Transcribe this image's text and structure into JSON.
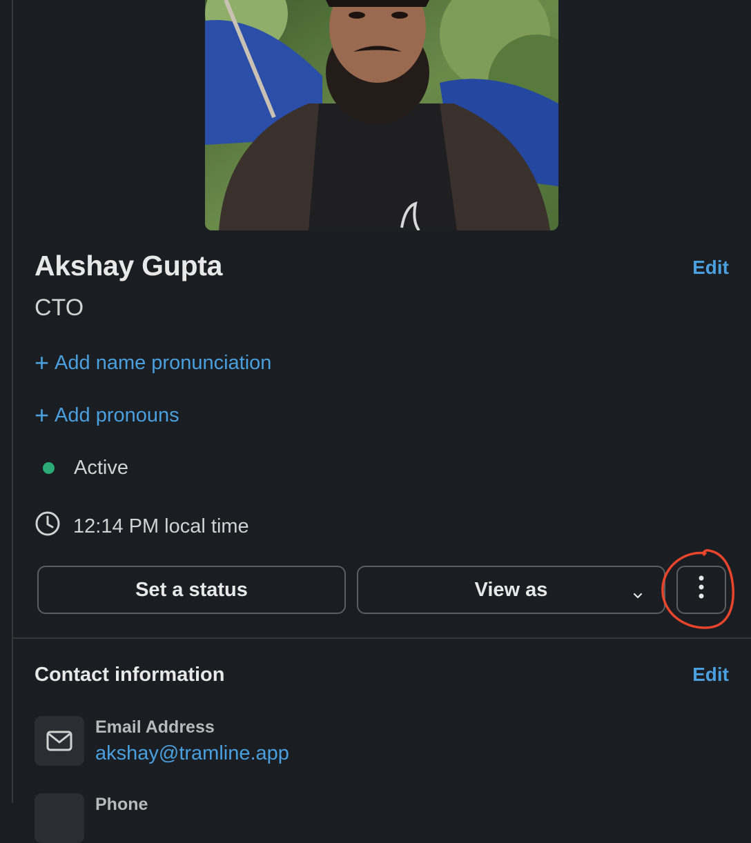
{
  "profile": {
    "name": "Akshay Gupta",
    "title": "CTO",
    "edit_label": "Edit",
    "add_pronunciation": "Add name pronunciation",
    "add_pronouns": "Add pronouns",
    "presence": "Active",
    "local_time": "12:14 PM local time",
    "photo_alt": "profile-photo"
  },
  "actions": {
    "set_status": "Set a status",
    "view_as": "View as",
    "more_icon": "vertical-ellipsis-icon"
  },
  "contact": {
    "section_title": "Contact information",
    "edit_label": "Edit",
    "fields": [
      {
        "label": "Email Address",
        "value": "akshay@tramline.app",
        "icon": "mail-icon"
      },
      {
        "label": "Phone",
        "value": "",
        "icon": "phone-icon"
      }
    ]
  },
  "colors": {
    "background": "#1a1d21",
    "link": "#4a9fdf",
    "presence_active": "#2bac76",
    "annotation": "#e8452c"
  }
}
